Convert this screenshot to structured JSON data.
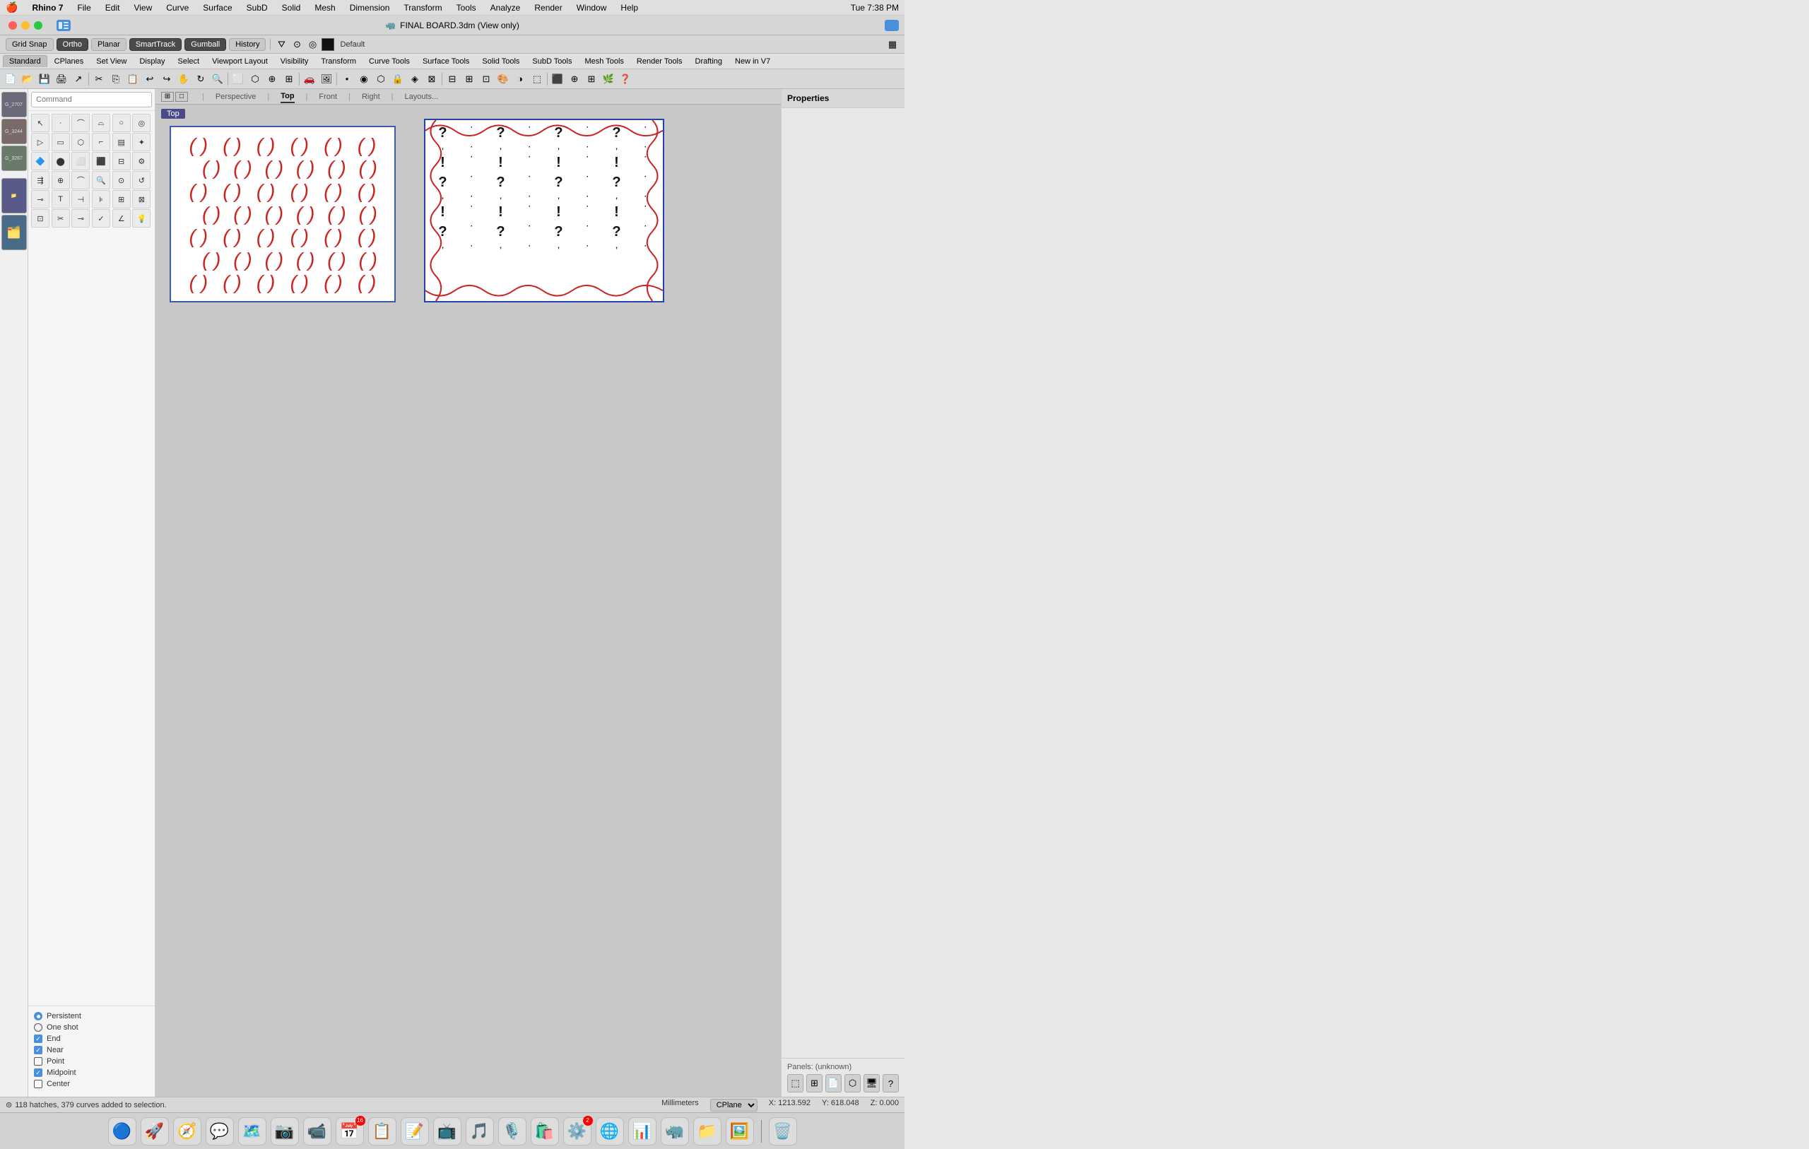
{
  "window": {
    "title": "FINAL BOARD.3dm (View only)",
    "app": "Rhino 7"
  },
  "menubar": {
    "apple": "🍎",
    "app_name": "Rhino 7",
    "menus": [
      "File",
      "Edit",
      "View",
      "Curve",
      "Surface",
      "SubD",
      "Solid",
      "Mesh",
      "Dimension",
      "Transform",
      "Tools",
      "Analyze",
      "Render",
      "Window",
      "Help"
    ],
    "time": "Tue 7:38 PM"
  },
  "toolbar1": {
    "grid_snap": "Grid Snap",
    "ortho": "Ortho",
    "planar": "Planar",
    "smart_track": "SmartTrack",
    "gumball": "Gumball",
    "history": "History",
    "default_label": "Default"
  },
  "toolbar2": {
    "tabs": [
      "Standard",
      "CPlanes",
      "Set View",
      "Display",
      "Select",
      "Viewport Layout",
      "Visibility",
      "Transform",
      "Curve Tools",
      "Surface Tools",
      "Solid Tools",
      "SubD Tools",
      "Mesh Tools",
      "Render Tools",
      "Drafting",
      "New in V7"
    ]
  },
  "viewport_tabs": {
    "tabs": [
      "Perspective",
      "Top",
      "Front",
      "Right",
      "Layouts..."
    ],
    "active": "Top"
  },
  "viewport_label": "Top",
  "command_panel": {
    "placeholder": "Command",
    "snap_options": {
      "persistent": {
        "label": "Persistent",
        "type": "radio",
        "checked": true
      },
      "one_shot": {
        "label": "One shot",
        "type": "radio",
        "checked": false
      },
      "end": {
        "label": "End",
        "type": "checkbox",
        "checked": true
      },
      "near": {
        "label": "Near",
        "type": "checkbox",
        "checked": true
      },
      "point": {
        "label": "Point",
        "type": "checkbox",
        "checked": false
      },
      "midpoint": {
        "label": "Midpoint",
        "type": "checkbox",
        "checked": true
      },
      "center": {
        "label": "Center",
        "type": "checkbox",
        "checked": false
      }
    }
  },
  "right_panel": {
    "title": "Properties",
    "panels_label": "Panels: (unknown)"
  },
  "statusbar": {
    "message": "118 hatches, 379 curves added to selection.",
    "units": "Millimeters",
    "cplane": "CPlane",
    "x": "X: 1213.592",
    "y": "Y: 618.048",
    "z": "Z: 0.000"
  },
  "dock": {
    "items": [
      {
        "name": "finder",
        "emoji": "🔵",
        "label": "Finder"
      },
      {
        "name": "launchpad",
        "emoji": "🚀",
        "label": "Launchpad"
      },
      {
        "name": "safari",
        "emoji": "🧭",
        "label": "Safari"
      },
      {
        "name": "messages",
        "emoji": "💬",
        "label": "Messages"
      },
      {
        "name": "maps",
        "emoji": "🗺️",
        "label": "Maps"
      },
      {
        "name": "photos",
        "emoji": "📷",
        "label": "Photos"
      },
      {
        "name": "facetime",
        "emoji": "📹",
        "label": "FaceTime"
      },
      {
        "name": "calendar",
        "emoji": "📅",
        "label": "Calendar",
        "badge": "16"
      },
      {
        "name": "notes",
        "emoji": "📝",
        "label": "Notes"
      },
      {
        "name": "notes2",
        "emoji": "📋",
        "label": "Stickies"
      },
      {
        "name": "tv",
        "emoji": "📺",
        "label": "TV"
      },
      {
        "name": "music",
        "emoji": "🎵",
        "label": "Music"
      },
      {
        "name": "podcasts",
        "emoji": "🎙️",
        "label": "Podcasts"
      },
      {
        "name": "appstore",
        "emoji": "🛍️",
        "label": "App Store"
      },
      {
        "name": "system",
        "emoji": "⚙️",
        "label": "System Preferences",
        "badge": "2"
      },
      {
        "name": "chrome",
        "emoji": "🌐",
        "label": "Chrome"
      },
      {
        "name": "powerpoint",
        "emoji": "📊",
        "label": "PowerPoint"
      },
      {
        "name": "rhino",
        "emoji": "🦏",
        "label": "Rhino"
      },
      {
        "name": "filemanager",
        "emoji": "📁",
        "label": "File Manager"
      },
      {
        "name": "finder2",
        "emoji": "🖥️",
        "label": "Finder"
      },
      {
        "name": "preview",
        "emoji": "🖼️",
        "label": "Preview"
      },
      {
        "name": "trash",
        "emoji": "🗑️",
        "label": "Trash"
      }
    ]
  },
  "icons": {
    "grid_snap": "⊞",
    "filter": "⌥",
    "camera": "📷",
    "cursor": "↖",
    "rhino_logo": "🦏"
  }
}
